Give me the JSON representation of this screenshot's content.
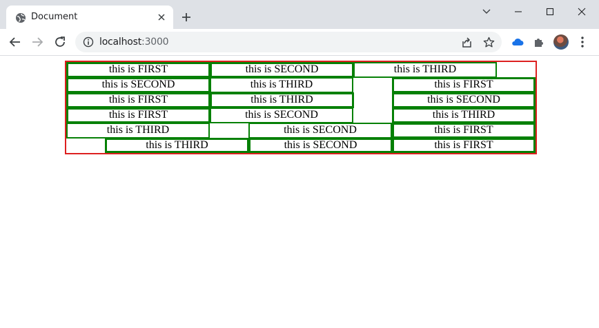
{
  "browser": {
    "tab_title": "Document",
    "url_host": "localhost",
    "url_port": ":3000",
    "icons": [
      "globe-icon",
      "close-icon",
      "plus-icon",
      "chevron-down-icon",
      "minimize-icon",
      "maximize-icon",
      "close-window-icon",
      "back-icon",
      "forward-icon",
      "reload-icon",
      "info-icon",
      "share-icon",
      "star-icon",
      "cloud-icon",
      "puzzle-icon",
      "avatar",
      "kebab-menu-icon"
    ]
  },
  "page": {
    "border_color": "#dd1f1f",
    "cell_border_color": "#058005",
    "rows": [
      {
        "cells": [
          "this is FIRST",
          "this is SECOND",
          "this is THIRD"
        ]
      },
      {
        "cells": [
          "this is SECOND",
          "this is THIRD",
          "this is FIRST"
        ]
      },
      {
        "cells": [
          "this is FIRST",
          "this is THIRD",
          "this is SECOND"
        ]
      },
      {
        "cells": [
          "this is FIRST",
          "this is SECOND",
          "this is THIRD"
        ]
      },
      {
        "cells": [
          "this is THIRD",
          "this is SECOND",
          "this is FIRST"
        ]
      },
      {
        "cells": [
          "this is THIRD",
          "this is SECOND",
          "this is FIRST"
        ]
      }
    ]
  }
}
